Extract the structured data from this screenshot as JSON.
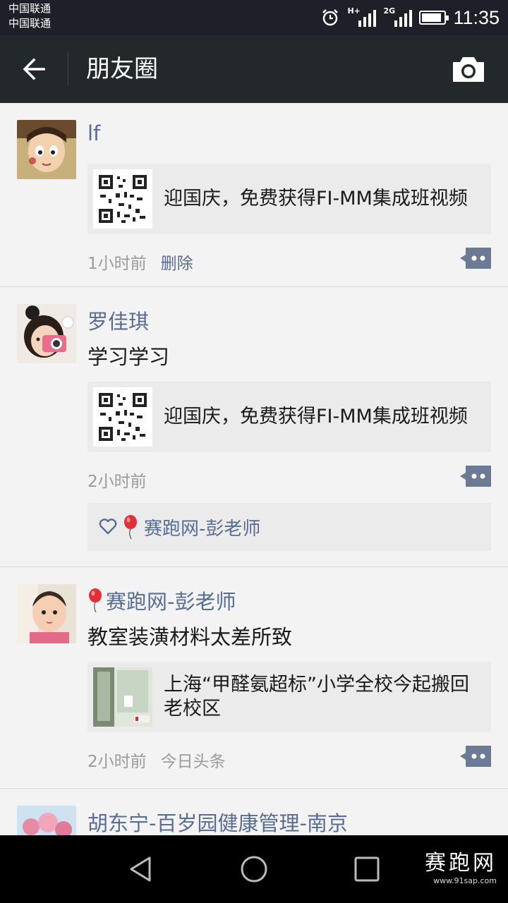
{
  "status_bar": {
    "carrier_1": "中国联通",
    "carrier_2": "中国联通",
    "signal_1_tag": "H+",
    "signal_2_tag": "2G",
    "battery_level": 0.9,
    "time": "11:35",
    "icons": [
      "alarm-icon",
      "signal-icon",
      "battery-icon"
    ]
  },
  "header": {
    "back_icon": "arrow-left-icon",
    "title": "朋友圈",
    "camera_icon": "camera-icon"
  },
  "posts": [
    {
      "name": "lf",
      "text": "",
      "link_title": "迎国庆，免费获得FI-MM集成班视频",
      "time": "1小时前",
      "action": "删除"
    },
    {
      "name": "罗佳琪",
      "text": "学习学习",
      "link_title": "迎国庆，免费获得FI-MM集成班视频",
      "time": "2小时前",
      "likes": [
        "赛跑网-彭老师"
      ]
    },
    {
      "name": "赛跑网-彭老师",
      "text": "教室装潢材料太差所致",
      "link_title": "上海“甲醛氨超标”小学全校今起搬回老校区",
      "time": "2小时前",
      "source": "今日头条"
    },
    {
      "name": "胡东宁-百岁园健康管理-南京"
    }
  ],
  "nav_bar": {
    "icons": [
      "back-triangle-icon",
      "home-circle-icon",
      "recents-square-icon"
    ],
    "watermark_main": "赛跑网",
    "watermark_url": "www.91sap.com"
  },
  "colors": {
    "name_blue": "#586c94",
    "header_bg": "#23282b",
    "card_bg": "#ebebeb"
  }
}
